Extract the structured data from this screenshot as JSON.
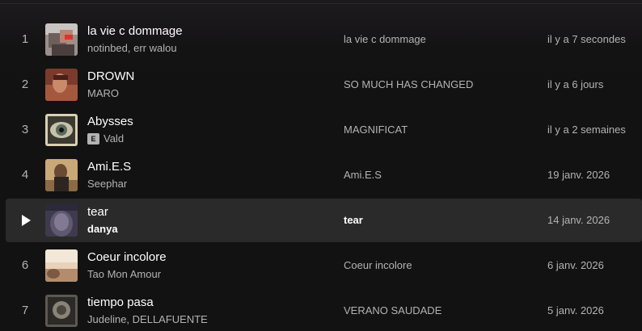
{
  "tracks": [
    {
      "index": "1",
      "title": "la vie c dommage",
      "artists": "notinbed, err walou",
      "explicit": false,
      "album": "la vie c dommage",
      "added": "il y a 7 secondes",
      "active": false
    },
    {
      "index": "2",
      "title": "DROWN",
      "artists": "MARO",
      "explicit": false,
      "album": "SO MUCH HAS CHANGED",
      "added": "il y a 6 jours",
      "active": false
    },
    {
      "index": "3",
      "title": "Abysses",
      "artists": "Vald",
      "explicit": true,
      "explicit_label": "E",
      "album": "MAGNIFICAT",
      "added": "il y a 2 semaines",
      "active": false
    },
    {
      "index": "4",
      "title": "Ami.E.S",
      "artists": "Seephar",
      "explicit": false,
      "album": "Ami.E.S",
      "added": "19 janv. 2026",
      "active": false
    },
    {
      "index": "5",
      "title": "tear",
      "artists": "danya",
      "explicit": false,
      "album": "tear",
      "added": "14 janv. 2026",
      "active": true
    },
    {
      "index": "6",
      "title": "Coeur incolore",
      "artists": "Tao Mon Amour",
      "explicit": false,
      "album": "Coeur incolore",
      "added": "6 janv. 2026",
      "active": false
    },
    {
      "index": "7",
      "title": "tiempo pasa",
      "artists": "Judeline, DELLAFUENTE",
      "explicit": false,
      "album": "VERANO SAUDADE",
      "added": "5 janv. 2026",
      "active": false
    }
  ],
  "colors": {
    "background": "#121212",
    "row_hover": "#2a2a2a",
    "text_primary": "#ffffff",
    "text_secondary": "#b3b3b3"
  }
}
